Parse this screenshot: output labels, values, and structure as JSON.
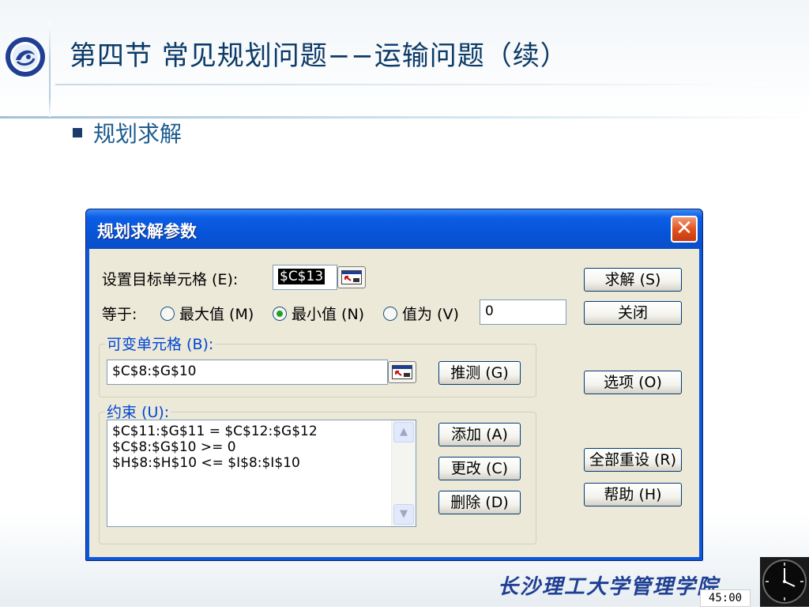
{
  "slide": {
    "title": "第四节  常见规划问题−−运输问题（续）",
    "bullet": "规划求解",
    "footer": "长沙理工大学管理学院",
    "timer": "45:00"
  },
  "dialog": {
    "title": "规划求解参数",
    "close_label": "✕",
    "target_label": "设置目标单元格 (E):",
    "target_value": "$C$13",
    "equal_label": "等于:",
    "radio_max": "最大值 (M)",
    "radio_min": "最小值 (N)",
    "radio_value": "值为 (V)",
    "selected_radio": "最小值 (N)",
    "value_field": "0",
    "changing_cells_label": "可变单元格 (B):",
    "changing_cells_value": "$C$8:$G$10",
    "constraints_label": "约束 (U):",
    "constraints": [
      "$C$11:$G$11 = $C$12:$G$12",
      "$C$8:$G$10 >= 0",
      "$H$8:$H$10 <= $I$8:$I$10"
    ],
    "buttons": {
      "solve": "求解 (S)",
      "close": "关闭",
      "guess": "推测 (G)",
      "options": "选项 (O)",
      "add": "添加 (A)",
      "change": "更改 (C)",
      "delete": "删除 (D)",
      "reset_all": "全部重设 (R)",
      "help": "帮助 (H)"
    }
  },
  "colors": {
    "title_text": "#0b3a66",
    "bullet_text": "#1d5c8f",
    "dialog_titlebar": "#0754d8",
    "dialog_body": "#ece9d8",
    "group_label": "#0046d5",
    "footer_text": "#1f3f93"
  },
  "icons": [
    "university-logo",
    "cell-reference-icon",
    "close-icon",
    "scroll-up-icon",
    "scroll-down-icon",
    "clock-icon"
  ]
}
